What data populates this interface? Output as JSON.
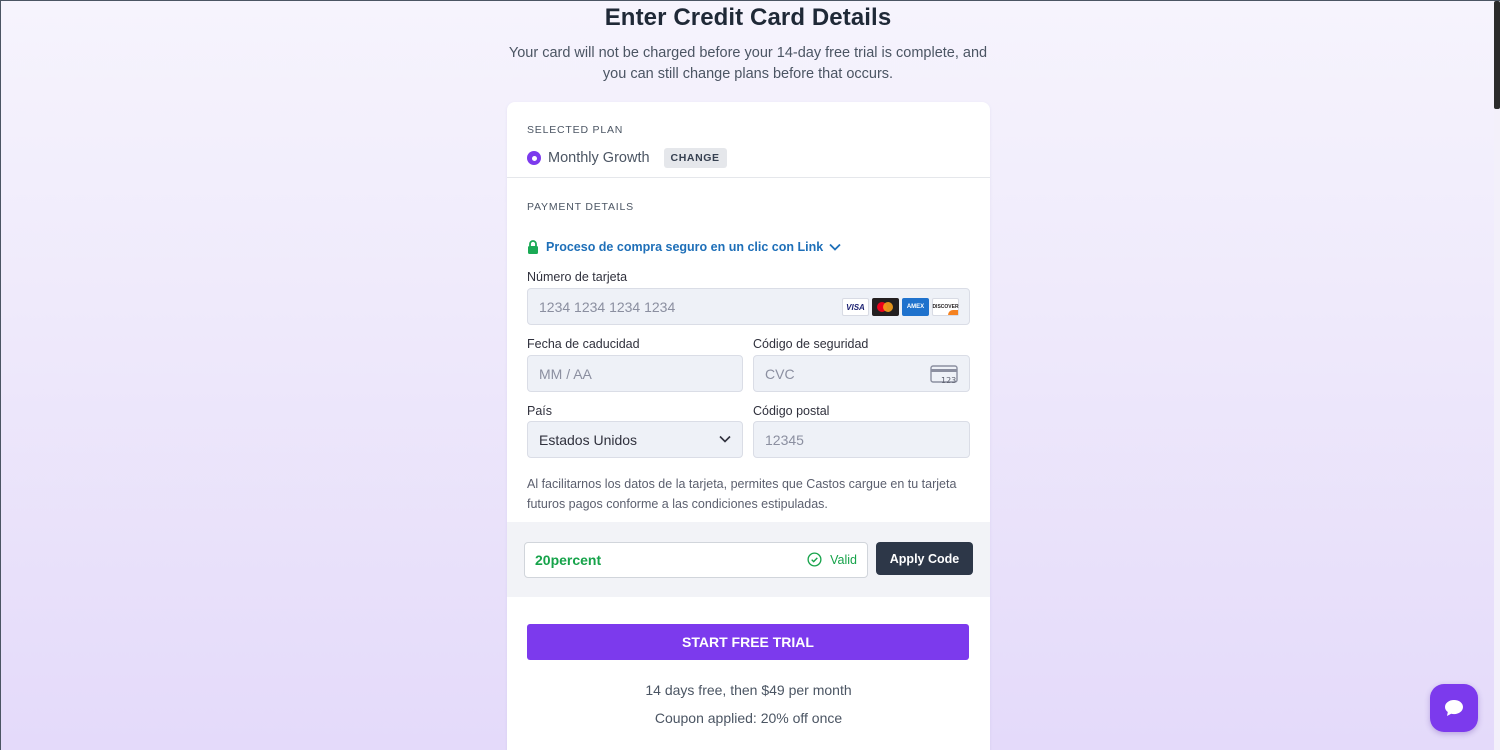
{
  "header": {
    "title": "Enter Credit Card Details",
    "subtitle": "Your card will not be charged before your 14-day free trial is complete, and you can still change plans before that occurs."
  },
  "plan": {
    "section_label": "SELECTED PLAN",
    "name": "Monthly Growth",
    "change_label": "CHANGE"
  },
  "payment": {
    "section_label": "PAYMENT DETAILS",
    "link_text": "Proceso de compra seguro en un clic con Link",
    "card_number_label": "Número de tarjeta",
    "card_number_placeholder": "1234 1234 1234 1234",
    "card_brands": [
      "VISA",
      "mastercard",
      "AMEX",
      "DISCOVER"
    ],
    "expiry_label": "Fecha de caducidad",
    "expiry_placeholder": "MM / AA",
    "cvc_label": "Código de seguridad",
    "cvc_placeholder": "CVC",
    "cvc_icon_text": "123",
    "country_label": "País",
    "country_value": "Estados Unidos",
    "postal_label": "Código postal",
    "postal_placeholder": "12345",
    "disclaimer": "Al facilitarnos los datos de la tarjeta, permites que Castos cargue en tu tarjeta futuros pagos conforme a las condiciones estipuladas."
  },
  "coupon": {
    "code": "20percent",
    "status": "Valid",
    "apply_label": "Apply Code"
  },
  "cta": {
    "start_label": "START FREE TRIAL",
    "pricing_text": "14 days free, then $49 per month",
    "coupon_text": "Coupon applied: 20% off once"
  },
  "colors": {
    "accent": "#7c3aed",
    "link": "#1e6fb8",
    "valid": "#16a34a",
    "apply_button": "#2d3748"
  }
}
